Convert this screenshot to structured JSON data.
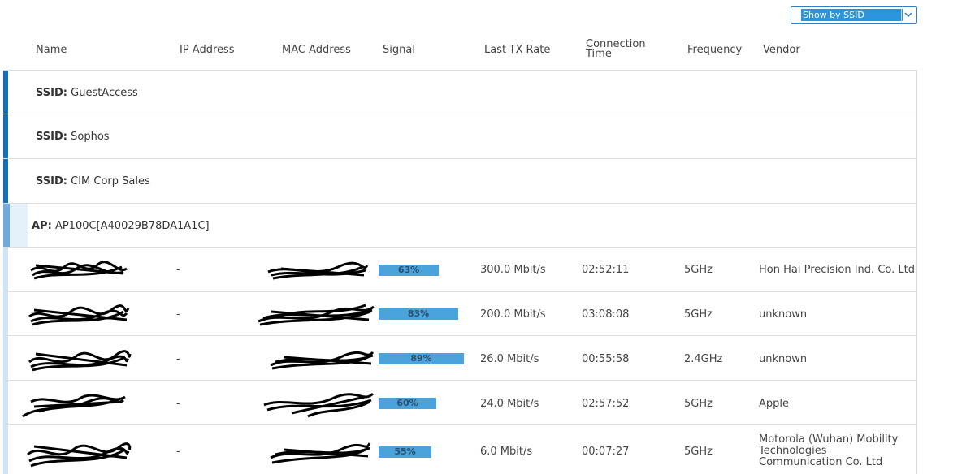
{
  "toolbar": {
    "view_select": {
      "value": "Show by SSID"
    }
  },
  "columns": [
    "Name",
    "IP Address",
    "MAC Address",
    "Signal",
    "Last-TX Rate",
    "Connection Time",
    "Frequency",
    "Vendor"
  ],
  "groups": [
    {
      "prefix": "SSID",
      "value": "GuestAccess"
    },
    {
      "prefix": "SSID",
      "value": "Sophos"
    },
    {
      "prefix": "SSID",
      "value": "CIM Corp Sales"
    }
  ],
  "ap": {
    "prefix": "AP",
    "value": "AP100C[A40029B78DA1A1C]"
  },
  "clients": [
    {
      "ip": "-",
      "signal_pct": 63,
      "signal_label": "63%",
      "rate": "300.0 Mbit/s",
      "time": "02:52:11",
      "freq": "5GHz",
      "vendor": "Hon Hai Precision Ind. Co. Ltd"
    },
    {
      "ip": "-",
      "signal_pct": 83,
      "signal_label": "83%",
      "rate": "200.0 Mbit/s",
      "time": "03:08:08",
      "freq": "5GHz",
      "vendor": "unknown"
    },
    {
      "ip": "-",
      "signal_pct": 89,
      "signal_label": "89%",
      "rate": "26.0 Mbit/s",
      "time": "00:55:58",
      "freq": "2.4GHz",
      "vendor": "unknown"
    },
    {
      "ip": "-",
      "signal_pct": 60,
      "signal_label": "60%",
      "rate": "24.0 Mbit/s",
      "time": "02:57:52",
      "freq": "5GHz",
      "vendor": "Apple"
    },
    {
      "ip": "-",
      "signal_pct": 55,
      "signal_label": "55%",
      "rate": "6.0 Mbit/s",
      "time": "00:07:27",
      "freq": "5GHz",
      "vendor": "Motorola (Wuhan) Mobility Technologies Communication Co. Ltd"
    }
  ],
  "colors": {
    "accent": "#1370b8",
    "signal_bar": "#4aa3da"
  },
  "icons": {
    "select_arrow": "chevron-down-icon",
    "redacted": "scribble"
  }
}
